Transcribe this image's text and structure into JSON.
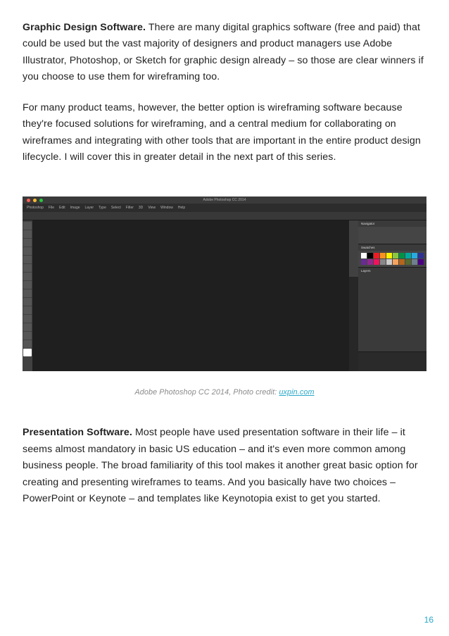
{
  "paragraphs": {
    "p1_lead": "Graphic Design Software.",
    "p1_body": " There are many digital graphics software (free and paid) that could be used but the vast majority of designers and product managers use Adobe Illustrator, Photoshop, or Sketch for graphic design already – so those are clear winners if you choose to use them for wireframing too.",
    "p2": "For many product teams, however, the better option is wireframing software because they're focused solutions for wireframing, and a central medium for collaborating on wireframes and integrating with other tools that are important in the entire product design lifecycle. I will cover this in greater detail in the next part of this series.",
    "p3_lead": "Presentation Software.",
    "p3_body": " Most people have used presentation software in their life – it seems almost mandatory in basic US education – and it's even more common among business people. The broad familiarity of this tool makes it another great basic option for creating and presenting wireframes to teams. And you basically have two choices – PowerPoint or Keynote – and templates like Keynotopia exist to get you started."
  },
  "screenshot": {
    "window_title": "Adobe Photoshop CC 2014",
    "menu": [
      "Photoshop",
      "File",
      "Edit",
      "Image",
      "Layer",
      "Type",
      "Select",
      "Filter",
      "3D",
      "View",
      "Window",
      "Help"
    ],
    "panel_labels": {
      "nav": "Navigator",
      "swatches": "Swatches",
      "layers": "Layers"
    },
    "swatch_colors": [
      "#ffffff",
      "#000000",
      "#ed1c24",
      "#f7931e",
      "#fff200",
      "#8cc63f",
      "#009245",
      "#00a99d",
      "#29abe2",
      "#2e3192",
      "#662d91",
      "#93278f",
      "#ed145b",
      "#888888",
      "#cccccc",
      "#f4a460",
      "#b5651d",
      "#556b2f",
      "#708090",
      "#4b0082"
    ]
  },
  "caption": {
    "text": "Adobe Photoshop CC 2014, Photo credit: ",
    "link_text": "uxpin.com"
  },
  "page_number": "16"
}
